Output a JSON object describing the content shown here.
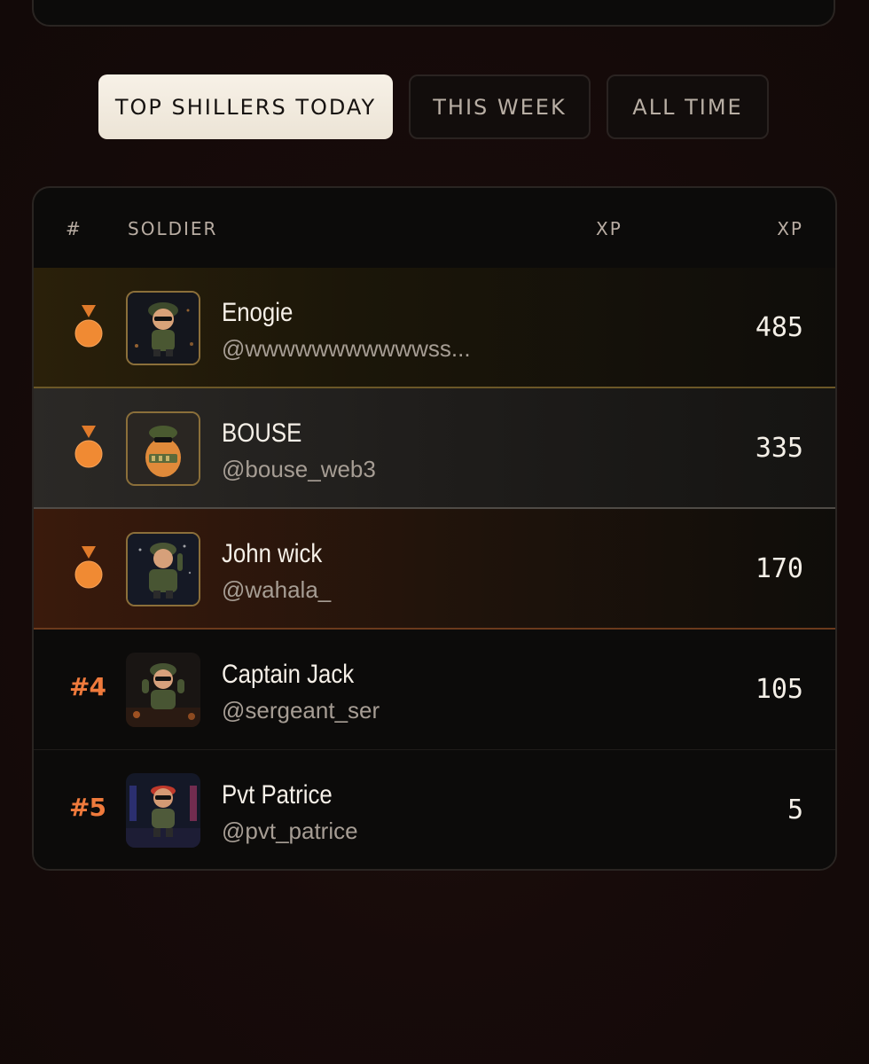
{
  "tabs": [
    {
      "label": "TOP SHILLERS TODAY",
      "active": true
    },
    {
      "label": "THIS WEEK",
      "active": false
    },
    {
      "label": "ALL TIME",
      "active": false
    }
  ],
  "table": {
    "headers": {
      "rank": "#",
      "soldier": "SOLDIER",
      "xp_left": "XP",
      "xp_right": "XP"
    },
    "rows": [
      {
        "rank_display": "medal",
        "rank_icon": "medal-gold-icon",
        "name": "Enogie",
        "handle": "@wwwwwwwwwwwss...",
        "xp": "485",
        "highlight_color": "#6b5727"
      },
      {
        "rank_display": "medal",
        "rank_icon": "medal-silver-icon",
        "name": "BOUSE",
        "handle": "@bouse_web3",
        "xp": "335",
        "highlight_color": "#4f4b46"
      },
      {
        "rank_display": "medal",
        "rank_icon": "medal-bronze-icon",
        "name": "John wick",
        "handle": "@wahala_",
        "xp": "170",
        "highlight_color": "#6b3a1c"
      },
      {
        "rank_display": "#4",
        "name": "Captain Jack",
        "handle": "@sergeant_ser",
        "xp": "105"
      },
      {
        "rank_display": "#5",
        "name": "Pvt Patrice",
        "handle": "@pvt_patrice",
        "xp": "5"
      }
    ]
  },
  "colors": {
    "accent_orange": "#ef7a3c",
    "medal": "#f08a33",
    "active_tab_bg": "#f3ece0"
  }
}
